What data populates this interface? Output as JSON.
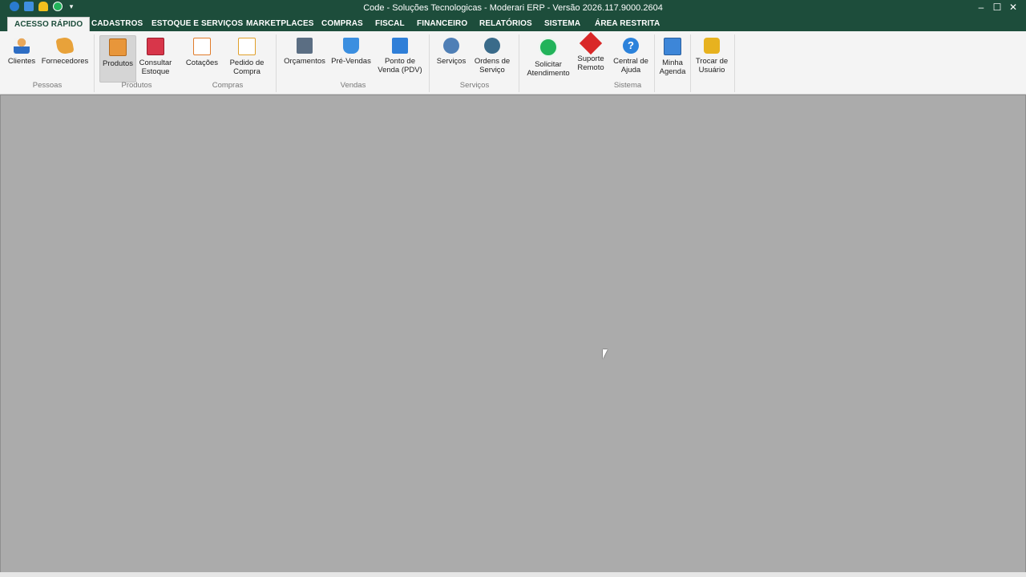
{
  "window": {
    "title": "Code - Soluções Tecnologicas - Moderari ERP - Versão 2026.117.9000.2604",
    "qat_more": "▾",
    "controls": {
      "minimize": "–",
      "maximize": "☐",
      "close": "✕"
    }
  },
  "tabs": [
    {
      "label": "ACESSO RÁPIDO",
      "active": true
    },
    {
      "label": "CADASTROS"
    },
    {
      "label": "ESTOQUE E SERVIÇOS"
    },
    {
      "label": "MARKETPLACES"
    },
    {
      "label": "COMPRAS"
    },
    {
      "label": "FISCAL"
    },
    {
      "label": "FINANCEIRO"
    },
    {
      "label": "RELATÓRIOS"
    },
    {
      "label": "SISTEMA"
    },
    {
      "label": "ÁREA RESTRITA"
    }
  ],
  "ribbon": {
    "groups": {
      "pessoas": "Pessoas",
      "produtos": "Produtos",
      "compras": "Compras",
      "vendas": "Vendas",
      "servicos": "Serviços",
      "sistema": "Sistema"
    },
    "buttons": {
      "clientes": [
        "Clientes"
      ],
      "fornecedores": [
        "Fornecedores"
      ],
      "produtos": [
        "Produtos"
      ],
      "consultar_estoque": [
        "Consultar",
        "Estoque"
      ],
      "cotacoes": [
        "Cotações"
      ],
      "pedido_compra": [
        "Pedido de",
        "Compra"
      ],
      "orcamentos": [
        "Orçamentos"
      ],
      "pre_vendas": [
        "Pré-Vendas"
      ],
      "pdv": [
        "Ponto de",
        "Venda (PDV)"
      ],
      "servicos": [
        "Serviços"
      ],
      "ordens_servico": [
        "Ordens de",
        "Serviço"
      ],
      "solicitar_atendimento": [
        "Solicitar",
        "Atendimento"
      ],
      "suporte_remoto": [
        "Suporte",
        "Remoto"
      ],
      "central_ajuda": [
        "Central de",
        "Ajuda"
      ],
      "minha_agenda": [
        "Minha",
        "Agenda"
      ],
      "trocar_usuario": [
        "Trocar de",
        "Usuário"
      ],
      "help_glyph": "?"
    }
  }
}
